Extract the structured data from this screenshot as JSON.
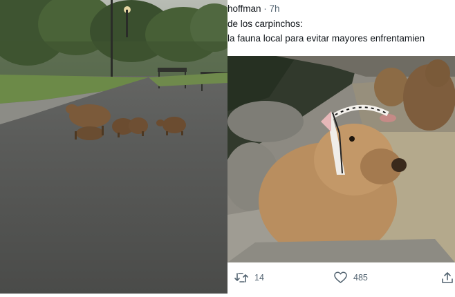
{
  "tweet": {
    "handle": "hoffman",
    "separator": " · ",
    "time": "7h",
    "line1": "de los carpinchos:",
    "line2": "la fauna local para evitar mayores enfrentamien"
  },
  "actions": {
    "retweet_count": "14",
    "like_count": "485"
  },
  "icons": [
    "retweet-icon",
    "heart-icon",
    "share-icon"
  ],
  "colors": {
    "muted": "#536471",
    "text": "#0f1419"
  }
}
